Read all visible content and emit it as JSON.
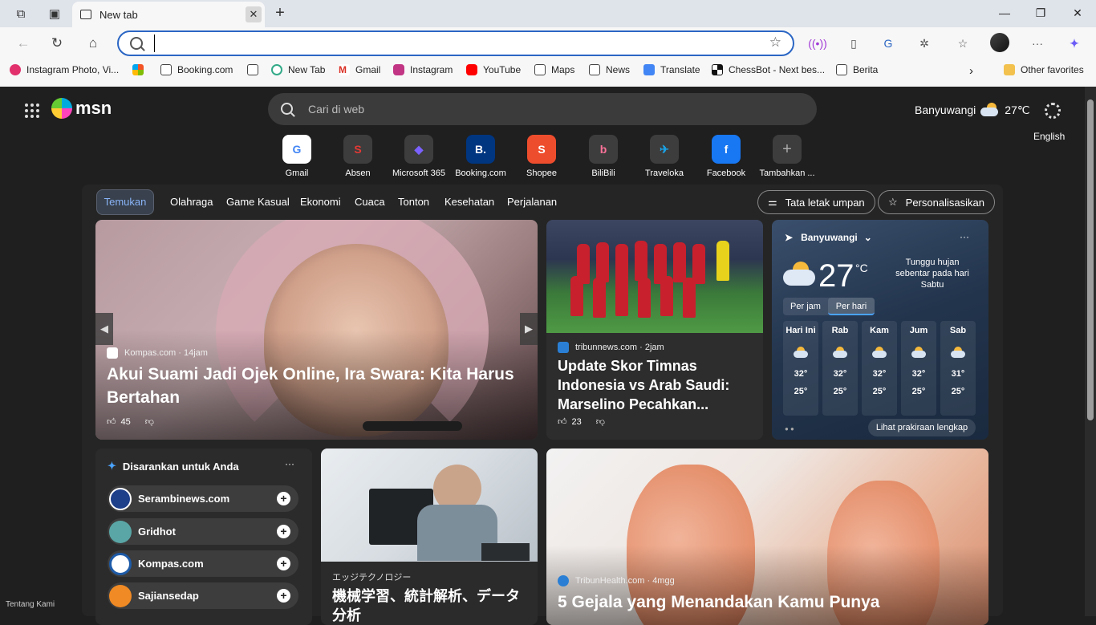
{
  "browser": {
    "tab_title": "New tab",
    "address_placeholder": "",
    "bookmarks": [
      "Instagram Photo, Vi...",
      "Booking.com",
      "New Tab",
      "Gmail",
      "Instagram",
      "YouTube",
      "Maps",
      "News",
      "Translate",
      "ChessBot - Next bes...",
      "Berita",
      "Other favorites"
    ]
  },
  "msn": {
    "logo": "msn",
    "search_placeholder": "Cari di web",
    "location": "Banyuwangi",
    "temp": "27℃",
    "language": "English",
    "quick_links": [
      "Gmail",
      "Absen",
      "Microsoft 365",
      "Booking.com",
      "Shopee",
      "BiliBili",
      "Traveloka",
      "Facebook",
      "Tambahkan ..."
    ],
    "tabs": [
      "Temukan",
      "Olahraga",
      "Game Kasual",
      "Ekonomi",
      "Cuaca",
      "Tonton",
      "Kesehatan",
      "Perjalanan"
    ],
    "layout_button": "Tata letak umpan",
    "personalize_button": "Personalisasikan",
    "hero": {
      "source": "Kompas.com",
      "age": "· 14jam",
      "title": "Akui Suami Jadi Ojek Online, Ira Swara: Kita Harus Bertahan",
      "likes": "45"
    },
    "sports": {
      "source": "tribunnews.com",
      "age": "· 2jam",
      "title": "Update Skor Timnas Indonesia vs Arab Saudi: Marselino Pecahkan...",
      "likes": "23"
    },
    "weather": {
      "location": "Banyuwangi",
      "more": "···",
      "temp": "27",
      "unit": "°C",
      "note": "Tunggu hujan sebentar pada hari Sabtu",
      "toggle_hourly": "Per jam",
      "toggle_daily": "Per hari",
      "days": [
        {
          "name": "Hari Ini",
          "high": "32°",
          "low": "25°"
        },
        {
          "name": "Rab",
          "high": "32°",
          "low": "25°"
        },
        {
          "name": "Kam",
          "high": "32°",
          "low": "25°"
        },
        {
          "name": "Jum",
          "high": "32°",
          "low": "25°"
        },
        {
          "name": "Sab",
          "high": "31°",
          "low": "25°"
        }
      ],
      "full_forecast": "Lihat prakiraan lengkap"
    },
    "suggested": {
      "title": "Disarankan untuk Anda",
      "more": "···",
      "items": [
        "Serambinews.com",
        "Gridhot",
        "Kompas.com",
        "Sajiansedap"
      ]
    },
    "jp_article": {
      "category": "エッジテクノロジー",
      "title": "機械学習、統計解析、データ分析"
    },
    "health_article": {
      "source": "TribunHealth.com",
      "age": "· 4mgg",
      "title": "5 Gejala yang Menandakan Kamu Punya"
    },
    "about": "Tentang Kami"
  }
}
